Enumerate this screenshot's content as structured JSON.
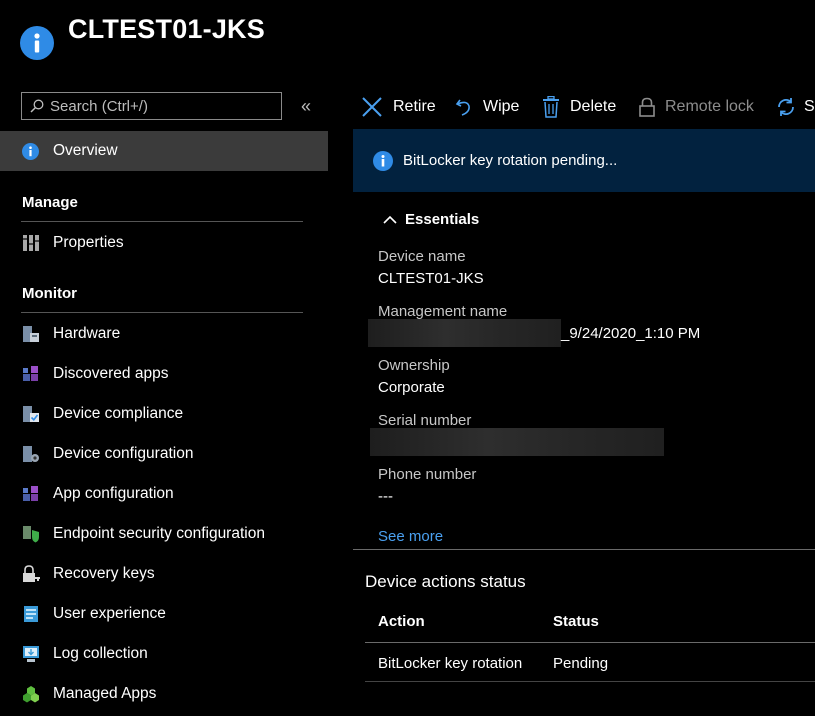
{
  "header": {
    "title": "CLTEST01-JKS",
    "icon": "info-icon"
  },
  "sidebar": {
    "search_placeholder": "Search (Ctrl+/)",
    "collapse_glyph": "«",
    "overview": "Overview",
    "manage_section": "Manage",
    "properties": "Properties",
    "monitor_section": "Monitor",
    "items": [
      {
        "label": "Hardware",
        "icon": "hardware-icon"
      },
      {
        "label": "Discovered apps",
        "icon": "discovered-apps-icon"
      },
      {
        "label": "Device compliance",
        "icon": "device-compliance-icon"
      },
      {
        "label": "Device configuration",
        "icon": "device-configuration-icon"
      },
      {
        "label": "App configuration",
        "icon": "app-configuration-icon"
      },
      {
        "label": "Endpoint security configuration",
        "icon": "endpoint-security-icon"
      },
      {
        "label": "Recovery keys",
        "icon": "recovery-keys-icon"
      },
      {
        "label": "User experience",
        "icon": "user-experience-icon"
      },
      {
        "label": "Log collection",
        "icon": "log-collection-icon"
      },
      {
        "label": "Managed Apps",
        "icon": "managed-apps-icon"
      }
    ]
  },
  "toolbar": {
    "retire": "Retire",
    "wipe": "Wipe",
    "delete": "Delete",
    "remote_lock": "Remote lock",
    "sync": "S"
  },
  "banner": {
    "text": "BitLocker key rotation pending..."
  },
  "essentials": {
    "title": "Essentials",
    "device_name_label": "Device name",
    "device_name_value": "CLTEST01-JKS",
    "management_name_label": "Management name",
    "management_name_value": "_9/24/2020_1:10 PM",
    "ownership_label": "Ownership",
    "ownership_value": "Corporate",
    "serial_label": "Serial number",
    "phone_label": "Phone number",
    "phone_value": "---",
    "see_more": "See more"
  },
  "device_actions": {
    "title": "Device actions status",
    "columns": [
      "Action",
      "Status"
    ],
    "rows": [
      {
        "action": "BitLocker key rotation",
        "status": "Pending"
      }
    ]
  },
  "colors": {
    "accent": "#2f8be6",
    "banner": "#02223f",
    "link": "#4aa0f0",
    "selected": "#3b3b3b"
  }
}
